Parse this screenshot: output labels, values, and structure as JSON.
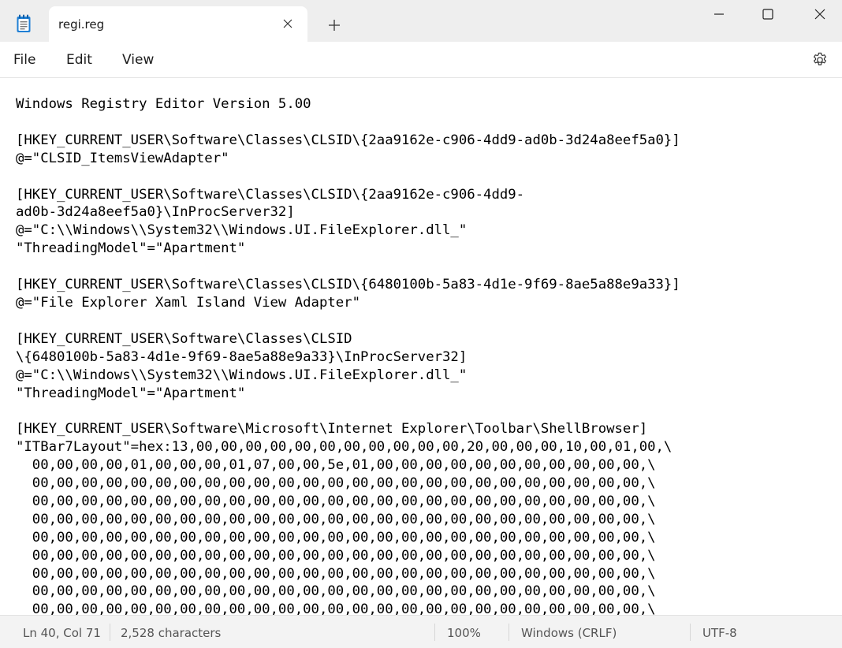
{
  "tab": {
    "title": "regi.reg"
  },
  "menu": {
    "file": "File",
    "edit": "Edit",
    "view": "View"
  },
  "editor": {
    "lines": [
      "Windows Registry Editor Version 5.00",
      "",
      "[HKEY_CURRENT_USER\\Software\\Classes\\CLSID\\{2aa9162e-c906-4dd9-ad0b-3d24a8eef5a0}]",
      "@=\"CLSID_ItemsViewAdapter\"",
      "",
      "[HKEY_CURRENT_USER\\Software\\Classes\\CLSID\\{2aa9162e-c906-4dd9-",
      "ad0b-3d24a8eef5a0}\\InProcServer32]",
      "@=\"C:\\\\Windows\\\\System32\\\\Windows.UI.FileExplorer.dll_\"",
      "\"ThreadingModel\"=\"Apartment\"",
      "",
      "[HKEY_CURRENT_USER\\Software\\Classes\\CLSID\\{6480100b-5a83-4d1e-9f69-8ae5a88e9a33}]",
      "@=\"File Explorer Xaml Island View Adapter\"",
      "",
      "[HKEY_CURRENT_USER\\Software\\Classes\\CLSID",
      "\\{6480100b-5a83-4d1e-9f69-8ae5a88e9a33}\\InProcServer32]",
      "@=\"C:\\\\Windows\\\\System32\\\\Windows.UI.FileExplorer.dll_\"",
      "\"ThreadingModel\"=\"Apartment\"",
      "",
      "[HKEY_CURRENT_USER\\Software\\Microsoft\\Internet Explorer\\Toolbar\\ShellBrowser]",
      "\"ITBar7Layout\"=hex:13,00,00,00,00,00,00,00,00,00,00,00,20,00,00,00,10,00,01,00,\\",
      "  00,00,00,00,01,00,00,00,01,07,00,00,5e,01,00,00,00,00,00,00,00,00,00,00,00,\\",
      "  00,00,00,00,00,00,00,00,00,00,00,00,00,00,00,00,00,00,00,00,00,00,00,00,00,\\",
      "  00,00,00,00,00,00,00,00,00,00,00,00,00,00,00,00,00,00,00,00,00,00,00,00,00,\\",
      "  00,00,00,00,00,00,00,00,00,00,00,00,00,00,00,00,00,00,00,00,00,00,00,00,00,\\",
      "  00,00,00,00,00,00,00,00,00,00,00,00,00,00,00,00,00,00,00,00,00,00,00,00,00,\\",
      "  00,00,00,00,00,00,00,00,00,00,00,00,00,00,00,00,00,00,00,00,00,00,00,00,00,\\",
      "  00,00,00,00,00,00,00,00,00,00,00,00,00,00,00,00,00,00,00,00,00,00,00,00,00,\\",
      "  00,00,00,00,00,00,00,00,00,00,00,00,00,00,00,00,00,00,00,00,00,00,00,00,00,\\",
      "  00,00,00,00,00,00,00,00,00,00,00,00,00,00,00,00,00,00,00,00,00,00,00,00,00,\\"
    ]
  },
  "status": {
    "position": "Ln 40, Col 71",
    "characters": "2,528 characters",
    "zoom": "100%",
    "line_ending": "Windows (CRLF)",
    "encoding": "UTF-8"
  },
  "icons": {
    "app": "notepad-icon",
    "close_tab": "close-icon",
    "new_tab": "plus-icon",
    "minimize": "minimize-icon",
    "maximize": "maximize-icon",
    "close_window": "close-icon",
    "settings": "gear-icon"
  },
  "colors": {
    "app_icon": "#1f7fd4",
    "titlebar": "#eeeeee",
    "statusbar": "#f3f3f3"
  }
}
